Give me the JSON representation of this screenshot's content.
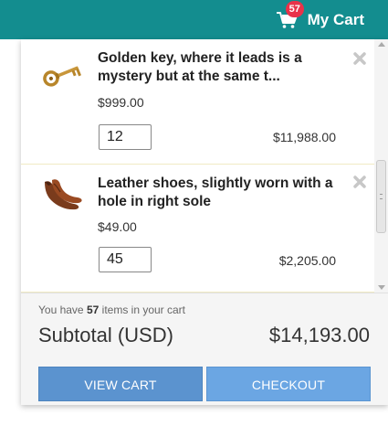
{
  "header": {
    "cart_label": "My Cart",
    "cart_count": "57",
    "icon": "shopping-cart-icon"
  },
  "items": [
    {
      "title": "Golden key, where it leads is a mystery but at the same t...",
      "price": "$999.00",
      "quantity": "12",
      "line_total": "$11,988.00",
      "thumbnail": "golden-key",
      "remove_icon": "close-icon"
    },
    {
      "title": "Leather shoes, slightly worn with a hole in right sole",
      "price": "$49.00",
      "quantity": "45",
      "line_total": "$2,205.00",
      "thumbnail": "leather-shoes",
      "remove_icon": "close-icon"
    }
  ],
  "summary": {
    "prefix": "You have ",
    "count": "57",
    "suffix": " items in your cart",
    "subtotal_label": "Subtotal (USD)",
    "subtotal_value": "$14,193.00"
  },
  "actions": {
    "view_cart": "VIEW CART",
    "checkout": "CHECKOUT"
  },
  "colors": {
    "header": "#138d8f",
    "badge": "#e8334a",
    "view_cart_button": "#5b93cf",
    "checkout_button": "#6ba6e3"
  }
}
